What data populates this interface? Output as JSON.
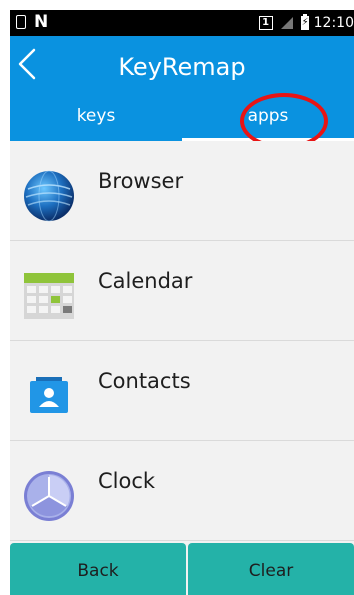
{
  "status_bar": {
    "time": "12:10",
    "sim_slot": "1",
    "icons": [
      "sim-card-icon",
      "nfc-icon",
      "sim1-icon",
      "signal-icon",
      "battery-charging-icon"
    ]
  },
  "header": {
    "title": "KeyRemap",
    "back_icon": "back-arrow-icon",
    "tabs": [
      {
        "label": "keys",
        "selected": false
      },
      {
        "label": "apps",
        "selected": true
      }
    ],
    "highlight_color": "#e81414"
  },
  "apps": [
    {
      "label": "Browser",
      "icon": "browser-icon"
    },
    {
      "label": "Calendar",
      "icon": "calendar-icon"
    },
    {
      "label": "Contacts",
      "icon": "contacts-icon"
    },
    {
      "label": "Clock",
      "icon": "clock-icon"
    }
  ],
  "buttons": {
    "back": "Back",
    "clear": "Clear"
  },
  "colors": {
    "header": "#0a92e0",
    "button": "#24b2a8",
    "background": "#f2f2f2"
  }
}
